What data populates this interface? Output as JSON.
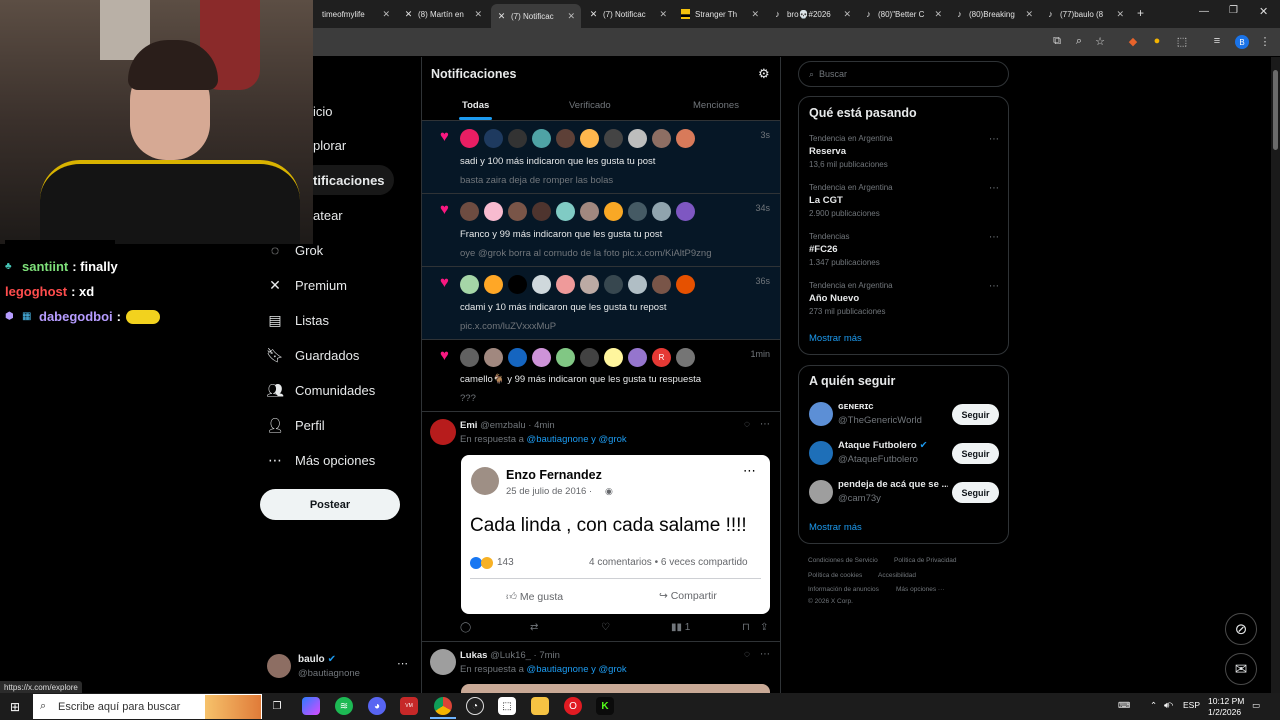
{
  "browser": {
    "tabs": [
      {
        "title": "timeofmylife",
        "icon": "x-logo-icon"
      },
      {
        "title": "(8) Martín en",
        "icon": "x-logo-icon"
      },
      {
        "title": "(7) Notificac",
        "icon": "x-logo-icon",
        "active": true
      },
      {
        "title": "(7) Notificac",
        "icon": "x-logo-icon"
      },
      {
        "title": "Stranger Th",
        "icon": "stranger-icon"
      },
      {
        "title": "bro💀#2026",
        "icon": "tiktok-icon"
      },
      {
        "title": "(80)\"Better C",
        "icon": "tiktok-icon"
      },
      {
        "title": "(80)Breaking",
        "icon": "tiktok-icon"
      },
      {
        "title": "(77)baulo (8",
        "icon": "tiktok-icon"
      }
    ],
    "new_tab": "+",
    "profile_letter": "B",
    "status_url": "https://x.com/explore"
  },
  "stream_chat": [
    {
      "user": "santiint",
      "message": ": finally",
      "color": "#7ee07a"
    },
    {
      "user": "legoghost",
      "message": ": xd",
      "color": "#ff4d4d"
    },
    {
      "user": "dabegodboi",
      "message": ":",
      "color": "#b69cff"
    }
  ],
  "nav": {
    "partial": [
      "icio",
      "plorar",
      "tificaciones",
      "atear"
    ],
    "items": [
      "Grok",
      "Premium",
      "Listas",
      "Guardados",
      "Comunidades",
      "Perfil",
      "Más opciones"
    ],
    "post_label": "Postear",
    "account_name": "baulo",
    "account_handle": "@bautiagnone"
  },
  "notifications": {
    "title": "Notificaciones",
    "tabs": [
      "Todas",
      "Verificado",
      "Menciones"
    ],
    "items": [
      {
        "time": "3s",
        "text": "sadi y 100 más indicaron que les gusta tu post",
        "sub": "basta zaira deja de romper las bolas"
      },
      {
        "time": "34s",
        "text": "Franco y 99 más indicaron que les gusta tu post",
        "sub": "oye @grok borra al cornudo de la foto pic.x.com/KiAltP9zng"
      },
      {
        "time": "36s",
        "text": "cdami y 10 más indicaron que les gusta tu repost",
        "sub": "pic.x.com/luZVxxxMuP"
      },
      {
        "time": "1min",
        "text": "camello🐐 y 99 más indicaron que les gusta tu respuesta",
        "sub": "???"
      }
    ],
    "reply1": {
      "name": "Emi",
      "handle": "@emzbalu · 4min",
      "reply_prefix": "En respuesta a",
      "reply_to": "@bautiagnone y @grok",
      "card": {
        "author": "Enzo Fernandez",
        "date": "25 de julio de 2016 ·",
        "text": "Cada linda , con cada salame !!!!",
        "reactions": "143",
        "comments": "4 comentarios • 6 veces compartido",
        "like_label": "Me gusta",
        "share_label": "Compartir"
      },
      "views": "1"
    },
    "reply2": {
      "name": "Lukas",
      "handle": "@Luk16_ · 7min",
      "reply_prefix": "En respuesta a",
      "reply_to": "@bautiagnone y @grok"
    }
  },
  "sidebar": {
    "search_placeholder": "Buscar",
    "trends_title": "Qué está pasando",
    "trends": [
      {
        "context": "Tendencia en Argentina",
        "name": "Reserva",
        "count": "13,6 mil publicaciones"
      },
      {
        "context": "Tendencia en Argentina",
        "name": "La CGT",
        "count": "2.900 publicaciones"
      },
      {
        "context": "Tendencias",
        "name": "#FC26",
        "count": "1.347 publicaciones"
      },
      {
        "context": "Tendencia en Argentina",
        "name": "Año Nuevo",
        "count": "273 mil publicaciones"
      }
    ],
    "show_more": "Mostrar más",
    "follow_title": "A quién seguir",
    "follow": [
      {
        "name": "ɢᴇɴᴇʀɪᴄ",
        "handle": "@TheGenericWorld",
        "button": "Seguir"
      },
      {
        "name": "Ataque Futbolero",
        "handle": "@AtaqueFutbolero",
        "button": "Seguir"
      },
      {
        "name": "pendeja de acá que se ...",
        "handle": "@cam73y",
        "button": "Seguir"
      }
    ],
    "follow_more": "Mostrar más",
    "footer": [
      "Condiciones de Servicio",
      "Política de Privacidad",
      "Política de cookies",
      "Accesibilidad",
      "Información de anuncios",
      "Más opciones ···",
      "© 2026 X Corp."
    ]
  },
  "taskbar": {
    "search_placeholder": "Escribe aquí para buscar",
    "lang": "ESP",
    "time": "10:12 PM",
    "date": "1/2/2026"
  },
  "colors": {
    "accent": "#1d9bf0",
    "like": "#f91880",
    "unread_bg": "#061726"
  }
}
